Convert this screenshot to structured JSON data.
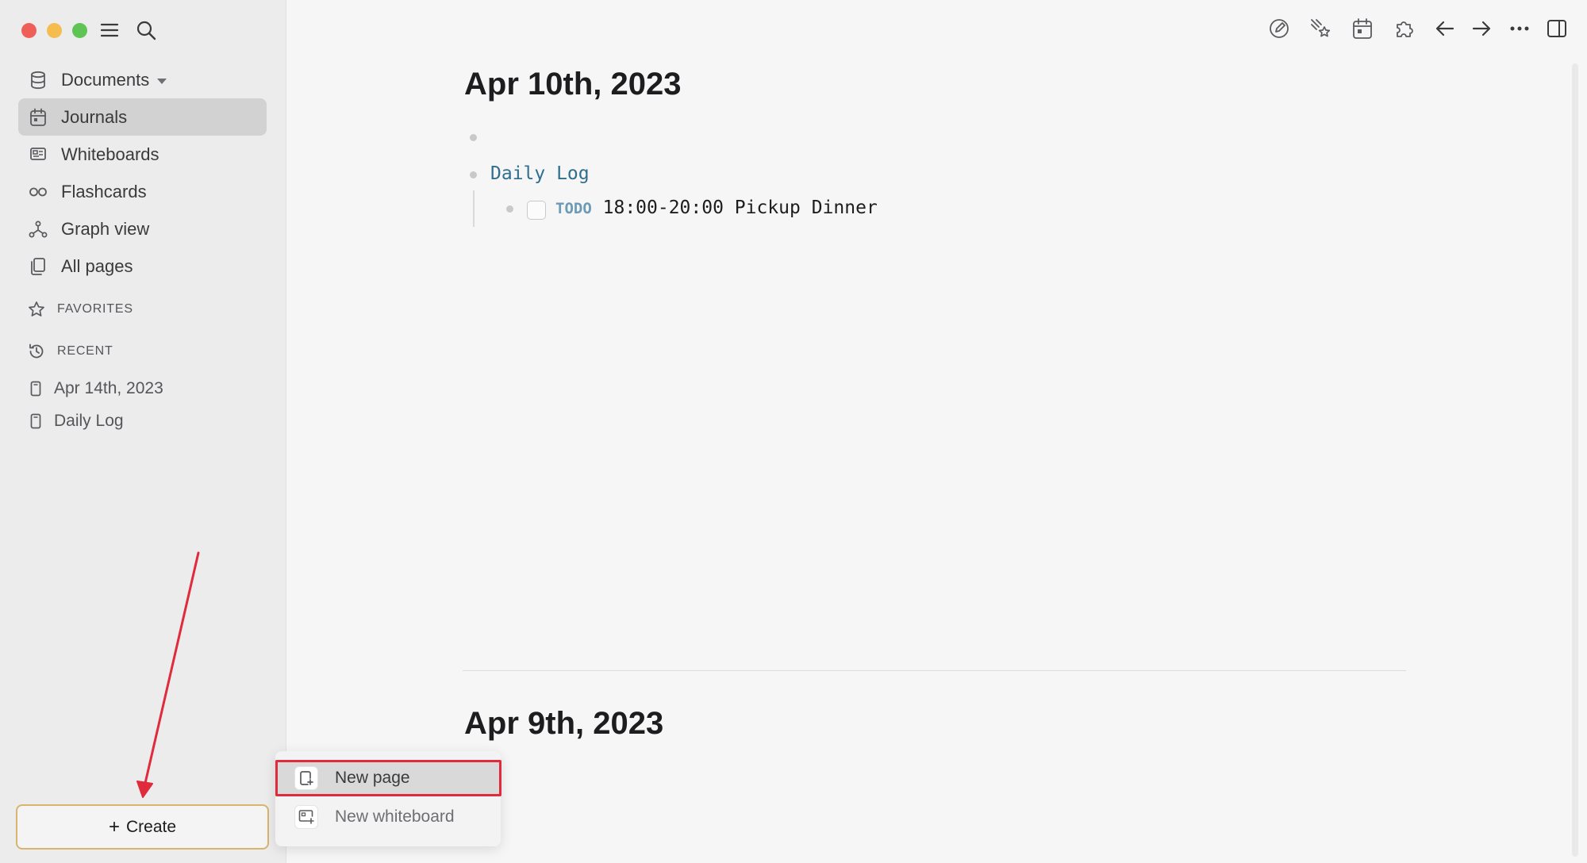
{
  "sidebar": {
    "nav": [
      {
        "label": "Documents",
        "icon": "database-icon"
      },
      {
        "label": "Journals",
        "icon": "calendar-icon",
        "active": true
      },
      {
        "label": "Whiteboards",
        "icon": "whiteboard-icon"
      },
      {
        "label": "Flashcards",
        "icon": "infinity-icon"
      },
      {
        "label": "Graph view",
        "icon": "graph-icon"
      },
      {
        "label": "All pages",
        "icon": "pages-icon"
      }
    ],
    "favorites_label": "FAVORITES",
    "recent_label": "RECENT",
    "recent": [
      {
        "label": "Apr 14th, 2023"
      },
      {
        "label": "Daily Log"
      }
    ],
    "create_label": "Create"
  },
  "journals": [
    {
      "title": "Apr 10th, 2023",
      "blocks": [
        {
          "text": ""
        },
        {
          "text": "Daily Log",
          "ref": true
        },
        {
          "marker": "TODO",
          "text": "18:00-20:00 Pickup Dinner"
        }
      ]
    },
    {
      "title": "Apr 9th, 2023"
    }
  ],
  "create_menu": [
    {
      "label": "New page",
      "icon": "new-page-icon"
    },
    {
      "label": "New whiteboard",
      "icon": "new-whiteboard-icon"
    }
  ],
  "colors": {
    "accent_ref": "#2f6e8e",
    "annotation_red": "#e02b3c",
    "create_border": "#d8b56e"
  }
}
